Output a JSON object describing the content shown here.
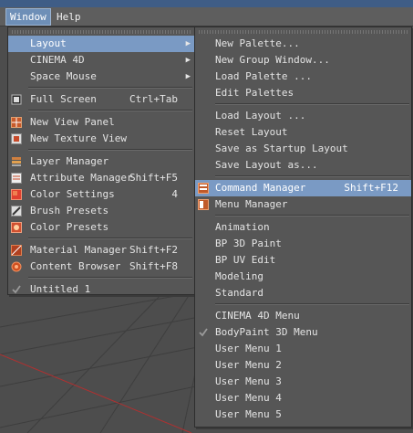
{
  "menubar": {
    "window": "Window",
    "help": "Help"
  },
  "window_menu": {
    "items": [
      {
        "label": "Layout",
        "shortcut": "",
        "submenu": true,
        "icon": "none"
      },
      {
        "label": "CINEMA 4D",
        "shortcut": "",
        "submenu": true,
        "icon": "none"
      },
      {
        "label": "Space Mouse",
        "shortcut": "",
        "submenu": true,
        "icon": "none"
      },
      {
        "label": "Full Screen",
        "shortcut": "Ctrl+Tab",
        "icon": "fullscreen-icon"
      },
      {
        "label": "New View Panel",
        "shortcut": "",
        "icon": "view-panel-icon"
      },
      {
        "label": "New Texture View",
        "shortcut": "",
        "icon": "texture-view-icon"
      },
      {
        "label": "Layer Manager",
        "shortcut": "",
        "icon": "layer-manager-icon"
      },
      {
        "label": "Attribute Manager",
        "shortcut": "Shift+F5",
        "icon": "attribute-manager-icon"
      },
      {
        "label": "Color Settings",
        "shortcut": "4",
        "icon": "color-settings-icon"
      },
      {
        "label": "Brush Presets",
        "shortcut": "",
        "icon": "brush-presets-icon"
      },
      {
        "label": "Color Presets",
        "shortcut": "",
        "icon": "color-presets-icon"
      },
      {
        "label": "Material Manager",
        "shortcut": "Shift+F2",
        "icon": "material-manager-icon"
      },
      {
        "label": "Content Browser",
        "shortcut": "Shift+F8",
        "icon": "content-browser-icon"
      },
      {
        "label": "Untitled 1",
        "shortcut": "",
        "icon": "check-icon"
      }
    ]
  },
  "layout_menu": {
    "items": [
      {
        "label": "New Palette..."
      },
      {
        "label": "New Group Window..."
      },
      {
        "label": "Load Palette ..."
      },
      {
        "label": "Edit Palettes"
      },
      {
        "label": "Load Layout ..."
      },
      {
        "label": "Reset Layout"
      },
      {
        "label": "Save as Startup Layout"
      },
      {
        "label": "Save Layout as..."
      },
      {
        "label": "Command Manager",
        "shortcut": "Shift+F12",
        "icon": "command-manager-icon"
      },
      {
        "label": "Menu Manager",
        "icon": "menu-manager-icon"
      },
      {
        "label": "Animation"
      },
      {
        "label": "BP 3D Paint"
      },
      {
        "label": "BP UV Edit"
      },
      {
        "label": "Modeling"
      },
      {
        "label": "Standard"
      },
      {
        "label": "CINEMA 4D Menu"
      },
      {
        "label": "BodyPaint 3D Menu",
        "icon": "check-icon"
      },
      {
        "label": "User Menu 1"
      },
      {
        "label": "User Menu 2"
      },
      {
        "label": "User Menu 3"
      },
      {
        "label": "User Menu 4"
      },
      {
        "label": "User Menu 5"
      }
    ]
  },
  "colors": {
    "highlight": "#7a9ac4",
    "menu_bg": "#565656",
    "title_blue": "#3f5d86"
  }
}
